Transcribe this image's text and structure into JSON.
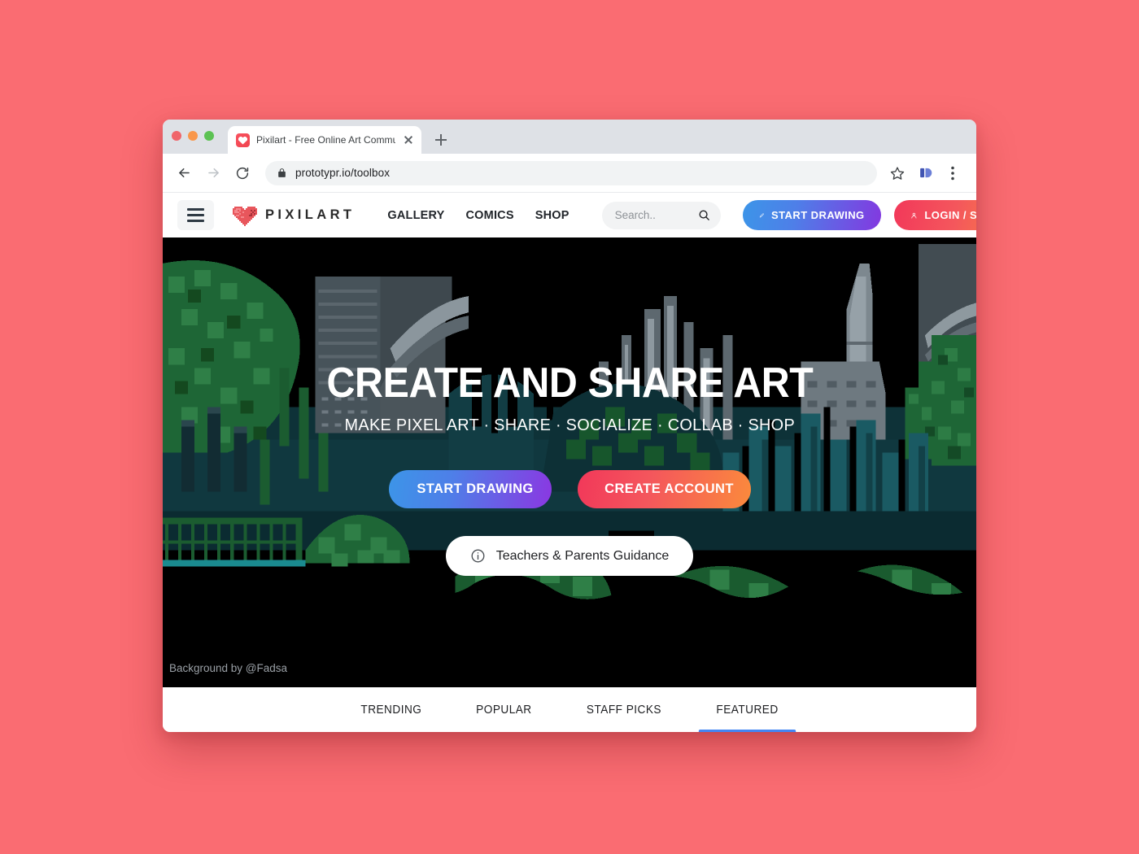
{
  "browser": {
    "tab": {
      "title": "Pixilart - Free Online Art Commun",
      "favicon_name": "pixilart-heart-favicon",
      "close_label": "",
      "newtab_label": ""
    },
    "toolbar": {
      "back_label": "",
      "forward_label": "",
      "reload_label": "",
      "lock_label": "",
      "url": "prototypr.io/toolbox",
      "bookmark_label": "",
      "profile_label": "",
      "menu_label": ""
    },
    "window_controls": {
      "close_color": "#f0656a",
      "minimize_color": "#f9974b",
      "maximize_color": "#5cc253"
    }
  },
  "page": {
    "header": {
      "menu_label": "",
      "brand": "PIXILART",
      "nav": [
        {
          "label": "GALLERY"
        },
        {
          "label": "COMICS"
        },
        {
          "label": "SHOP"
        }
      ],
      "search": {
        "placeholder": "Search..",
        "value": ""
      },
      "start_drawing_label": "START DRAWING",
      "login_label": "LOGIN / SIGN UP"
    },
    "hero": {
      "title": "CREATE AND SHARE ART",
      "subtitle": "MAKE PIXEL ART · SHARE · SOCIALIZE · COLLAB · SHOP",
      "start_drawing_label": "START DRAWING",
      "create_account_label": "CREATE ACCOUNT",
      "guidance_label": "Teachers & Parents Guidance",
      "credit": "Background by @Fadsa"
    },
    "content_tabs": {
      "items": [
        {
          "label": "TRENDING",
          "active": false
        },
        {
          "label": "POPULAR",
          "active": false
        },
        {
          "label": "STAFF PICKS",
          "active": false
        },
        {
          "label": "FEATURED",
          "active": true
        }
      ],
      "active_indicator_color": "#4285f4"
    }
  },
  "theme": {
    "page_background": "#fa6c72",
    "blue_gradient_start": "#3c95e8",
    "purple_gradient_end": "#8338e0",
    "pink_gradient_start": "#f2385a",
    "orange_gradient_end": "#fb8a3c",
    "hero_background": "#000000"
  }
}
